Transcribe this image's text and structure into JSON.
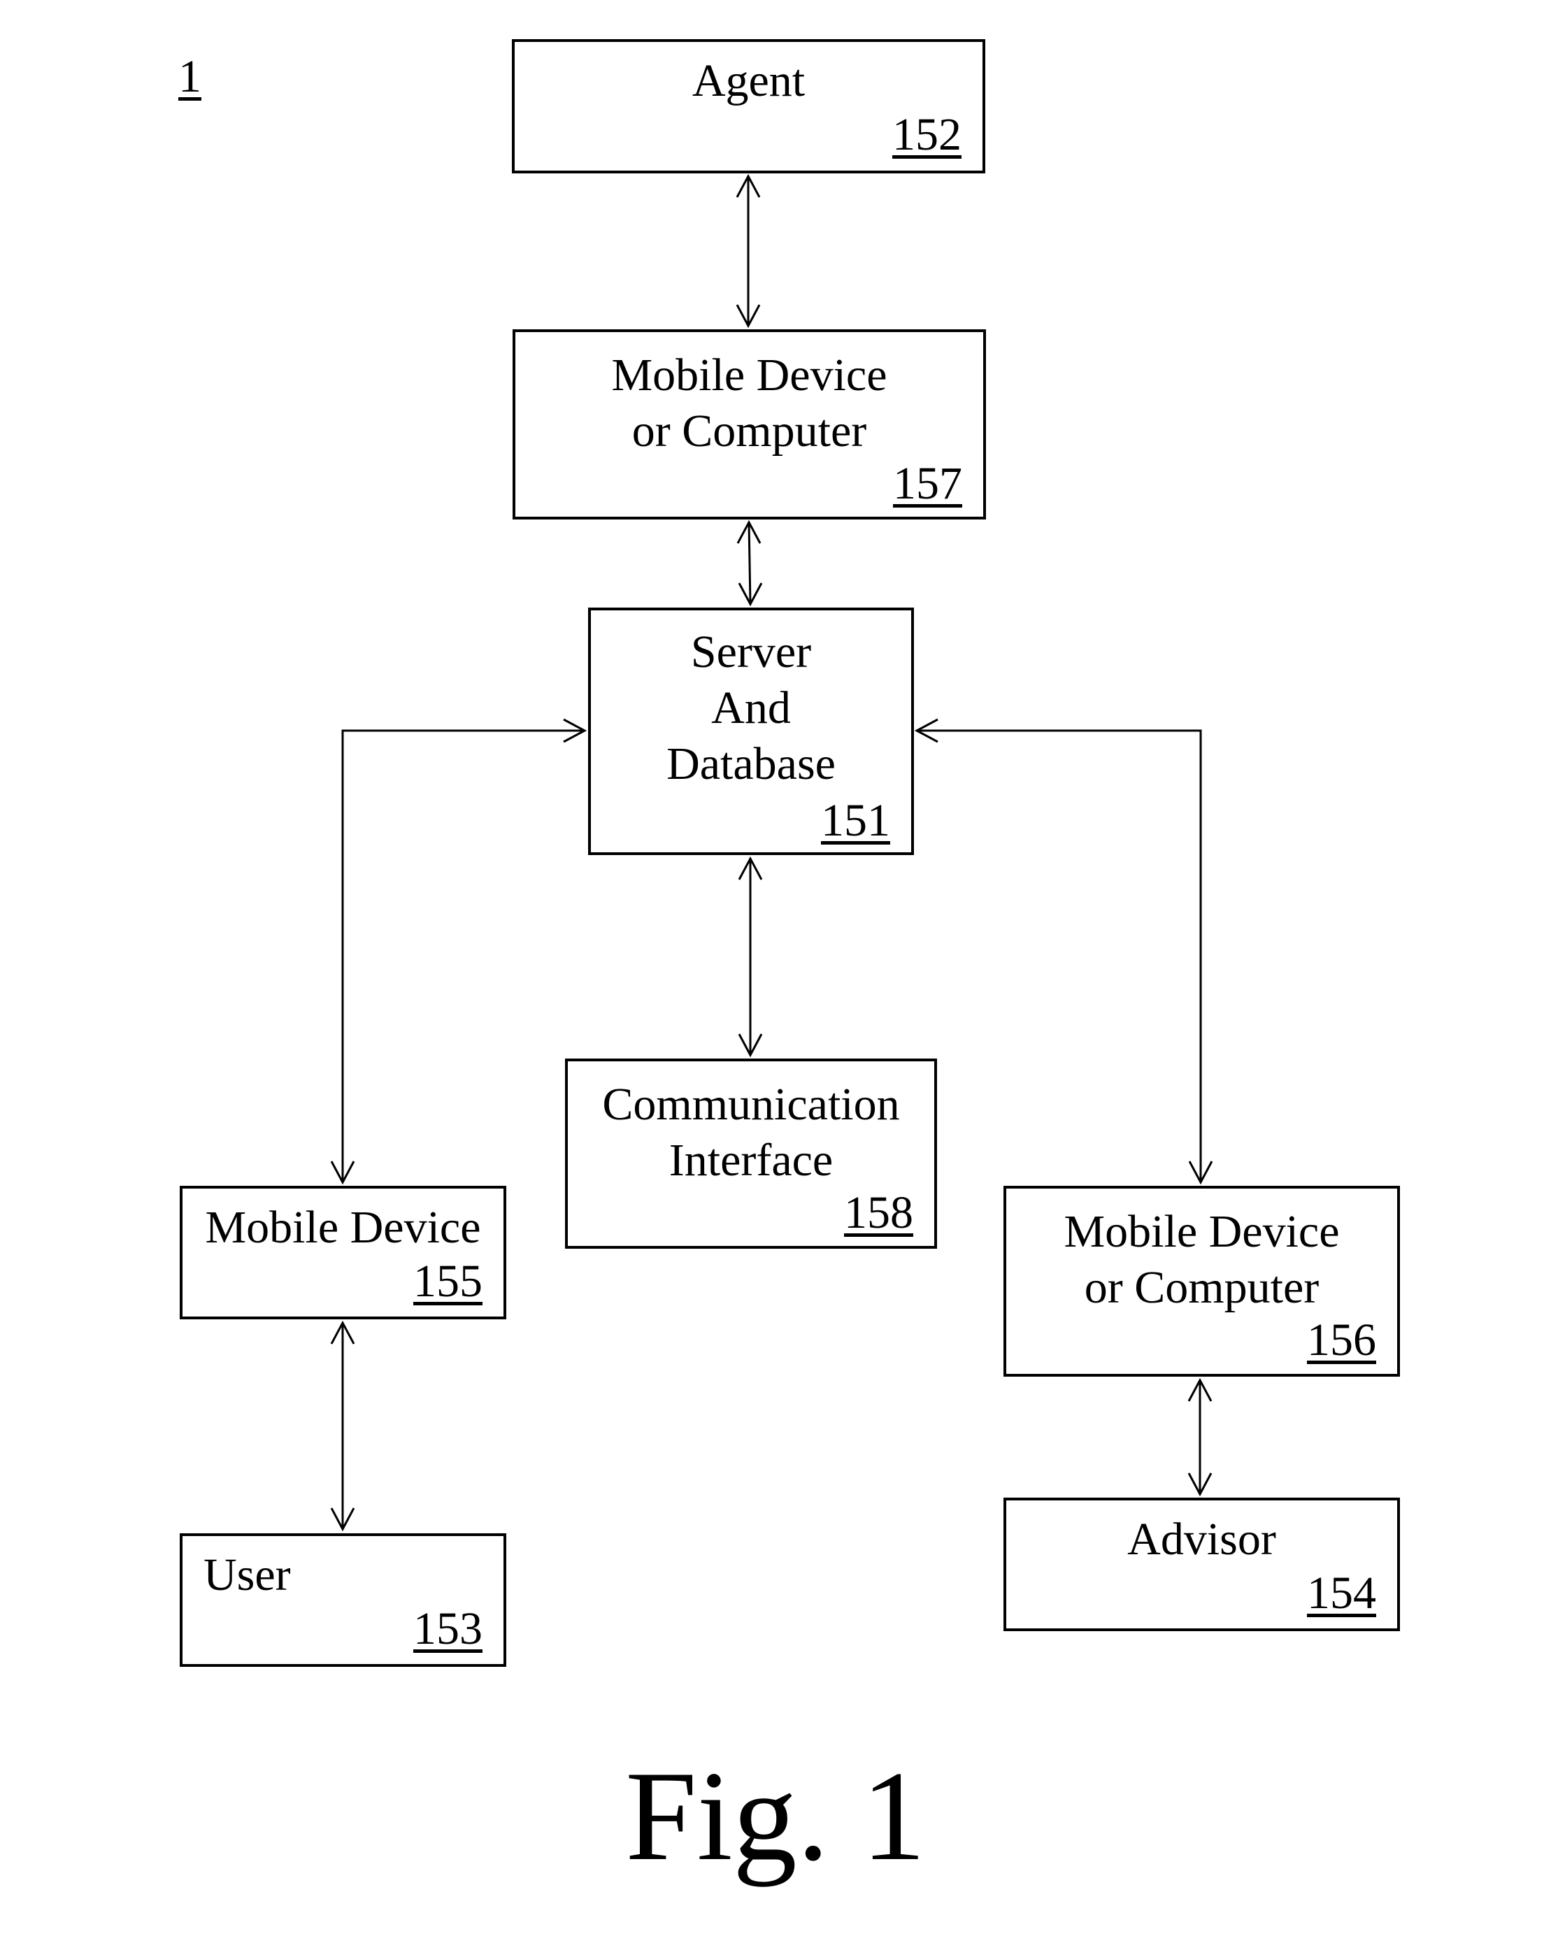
{
  "figure": {
    "reference_label": "1",
    "caption": "Fig. 1"
  },
  "nodes": {
    "agent": {
      "title": "Agent",
      "ref": "152"
    },
    "agent_device": {
      "title": "Mobile Device\nor Computer",
      "ref": "157"
    },
    "server": {
      "title": "Server\nAnd\nDatabase",
      "ref": "151"
    },
    "communication": {
      "title": "Communication\nInterface",
      "ref": "158"
    },
    "user_device": {
      "title": "Mobile Device",
      "ref": "155"
    },
    "user": {
      "title": "User",
      "ref": "153"
    },
    "advisor_device": {
      "title": "Mobile Device\nor Computer",
      "ref": "156"
    },
    "advisor": {
      "title": "Advisor",
      "ref": "154"
    }
  },
  "edges": [
    {
      "from": "agent",
      "to": "agent_device",
      "direction": "bidirectional"
    },
    {
      "from": "agent_device",
      "to": "server",
      "direction": "bidirectional"
    },
    {
      "from": "server",
      "to": "communication",
      "direction": "bidirectional"
    },
    {
      "from": "server",
      "to": "user_device",
      "direction": "bidirectional"
    },
    {
      "from": "server",
      "to": "advisor_device",
      "direction": "bidirectional"
    },
    {
      "from": "user_device",
      "to": "user",
      "direction": "bidirectional"
    },
    {
      "from": "advisor_device",
      "to": "advisor",
      "direction": "bidirectional"
    }
  ]
}
